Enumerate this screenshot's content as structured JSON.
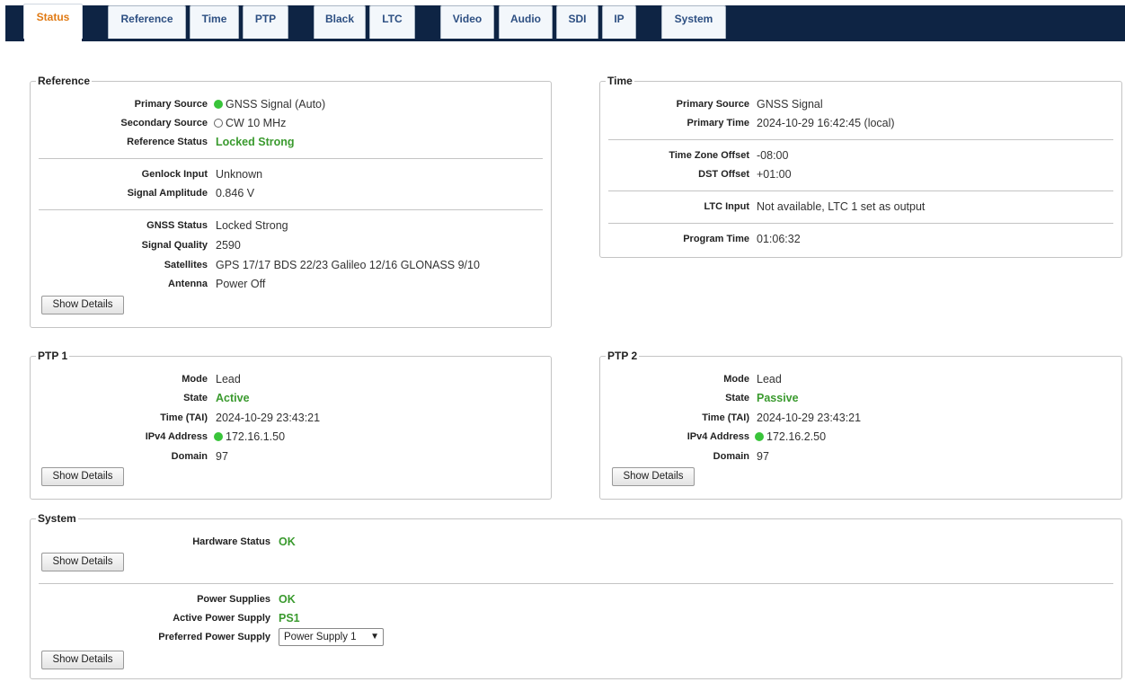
{
  "tabs": [
    {
      "label": "Status",
      "active": true
    },
    {
      "label": "Reference"
    },
    {
      "label": "Time"
    },
    {
      "label": "PTP"
    },
    {
      "label": "Black"
    },
    {
      "label": "LTC"
    },
    {
      "label": "Video"
    },
    {
      "label": "Audio"
    },
    {
      "label": "SDI"
    },
    {
      "label": "IP"
    },
    {
      "label": "System"
    }
  ],
  "reference": {
    "title": "Reference",
    "primary_source": {
      "label": "Primary Source",
      "value": "GNSS Signal (Auto)"
    },
    "secondary_source": {
      "label": "Secondary Source",
      "value": "CW 10 MHz"
    },
    "reference_status": {
      "label": "Reference Status",
      "value": "Locked Strong"
    },
    "genlock_input": {
      "label": "Genlock Input",
      "value": "Unknown"
    },
    "signal_amplitude": {
      "label": "Signal Amplitude",
      "value": "0.846 V"
    },
    "gnss_status": {
      "label": "GNSS Status",
      "value": "Locked Strong"
    },
    "signal_quality": {
      "label": "Signal Quality",
      "value": "2590"
    },
    "satellites": {
      "label": "Satellites",
      "value": "GPS 17/17 BDS 22/23 Galileo 12/16 GLONASS 9/10"
    },
    "antenna": {
      "label": "Antenna",
      "value": "Power Off"
    },
    "details_button": "Show Details"
  },
  "time": {
    "title": "Time",
    "primary_source": {
      "label": "Primary Source",
      "value": "GNSS Signal"
    },
    "primary_time": {
      "label": "Primary Time",
      "value": "2024-10-29 16:42:45 (local)"
    },
    "tz_offset": {
      "label": "Time Zone Offset",
      "value": "-08:00"
    },
    "dst_offset": {
      "label": "DST Offset",
      "value": "+01:00"
    },
    "ltc_input": {
      "label": "LTC Input",
      "value": "Not available, LTC 1 set as output"
    },
    "program_time": {
      "label": "Program Time",
      "value": "01:06:32"
    }
  },
  "ptp1": {
    "title": "PTP 1",
    "mode": {
      "label": "Mode",
      "value": "Lead"
    },
    "state": {
      "label": "State",
      "value": "Active"
    },
    "time": {
      "label": "Time (TAI)",
      "value": "2024-10-29 23:43:21"
    },
    "ipv4": {
      "label": "IPv4 Address",
      "value": "172.16.1.50"
    },
    "domain": {
      "label": "Domain",
      "value": "97"
    },
    "details_button": "Show Details"
  },
  "ptp2": {
    "title": "PTP 2",
    "mode": {
      "label": "Mode",
      "value": "Lead"
    },
    "state": {
      "label": "State",
      "value": "Passive"
    },
    "time": {
      "label": "Time (TAI)",
      "value": "2024-10-29 23:43:21"
    },
    "ipv4": {
      "label": "IPv4 Address",
      "value": "172.16.2.50"
    },
    "domain": {
      "label": "Domain",
      "value": "97"
    },
    "details_button": "Show Details"
  },
  "system": {
    "title": "System",
    "hardware_status": {
      "label": "Hardware Status",
      "value": "OK"
    },
    "hardware_details_button": "Show Details",
    "power_supplies": {
      "label": "Power Supplies",
      "value": "OK"
    },
    "active_power_supply": {
      "label": "Active Power Supply",
      "value": "PS1"
    },
    "preferred_power_supply": {
      "label": "Preferred Power Supply",
      "value": "Power Supply 1"
    },
    "power_details_button": "Show Details"
  },
  "colors": {
    "topbar": "#0e2444",
    "active_tab_text": "#e07a14",
    "tab_text": "#2d4f82",
    "ok_green": "#3a9a2e",
    "status_dot": "#39c43a"
  },
  "icons": {
    "status_led_on": "green-dot-icon",
    "status_led_off": "empty-circle-icon",
    "select_arrow": "chevron-down-icon"
  }
}
